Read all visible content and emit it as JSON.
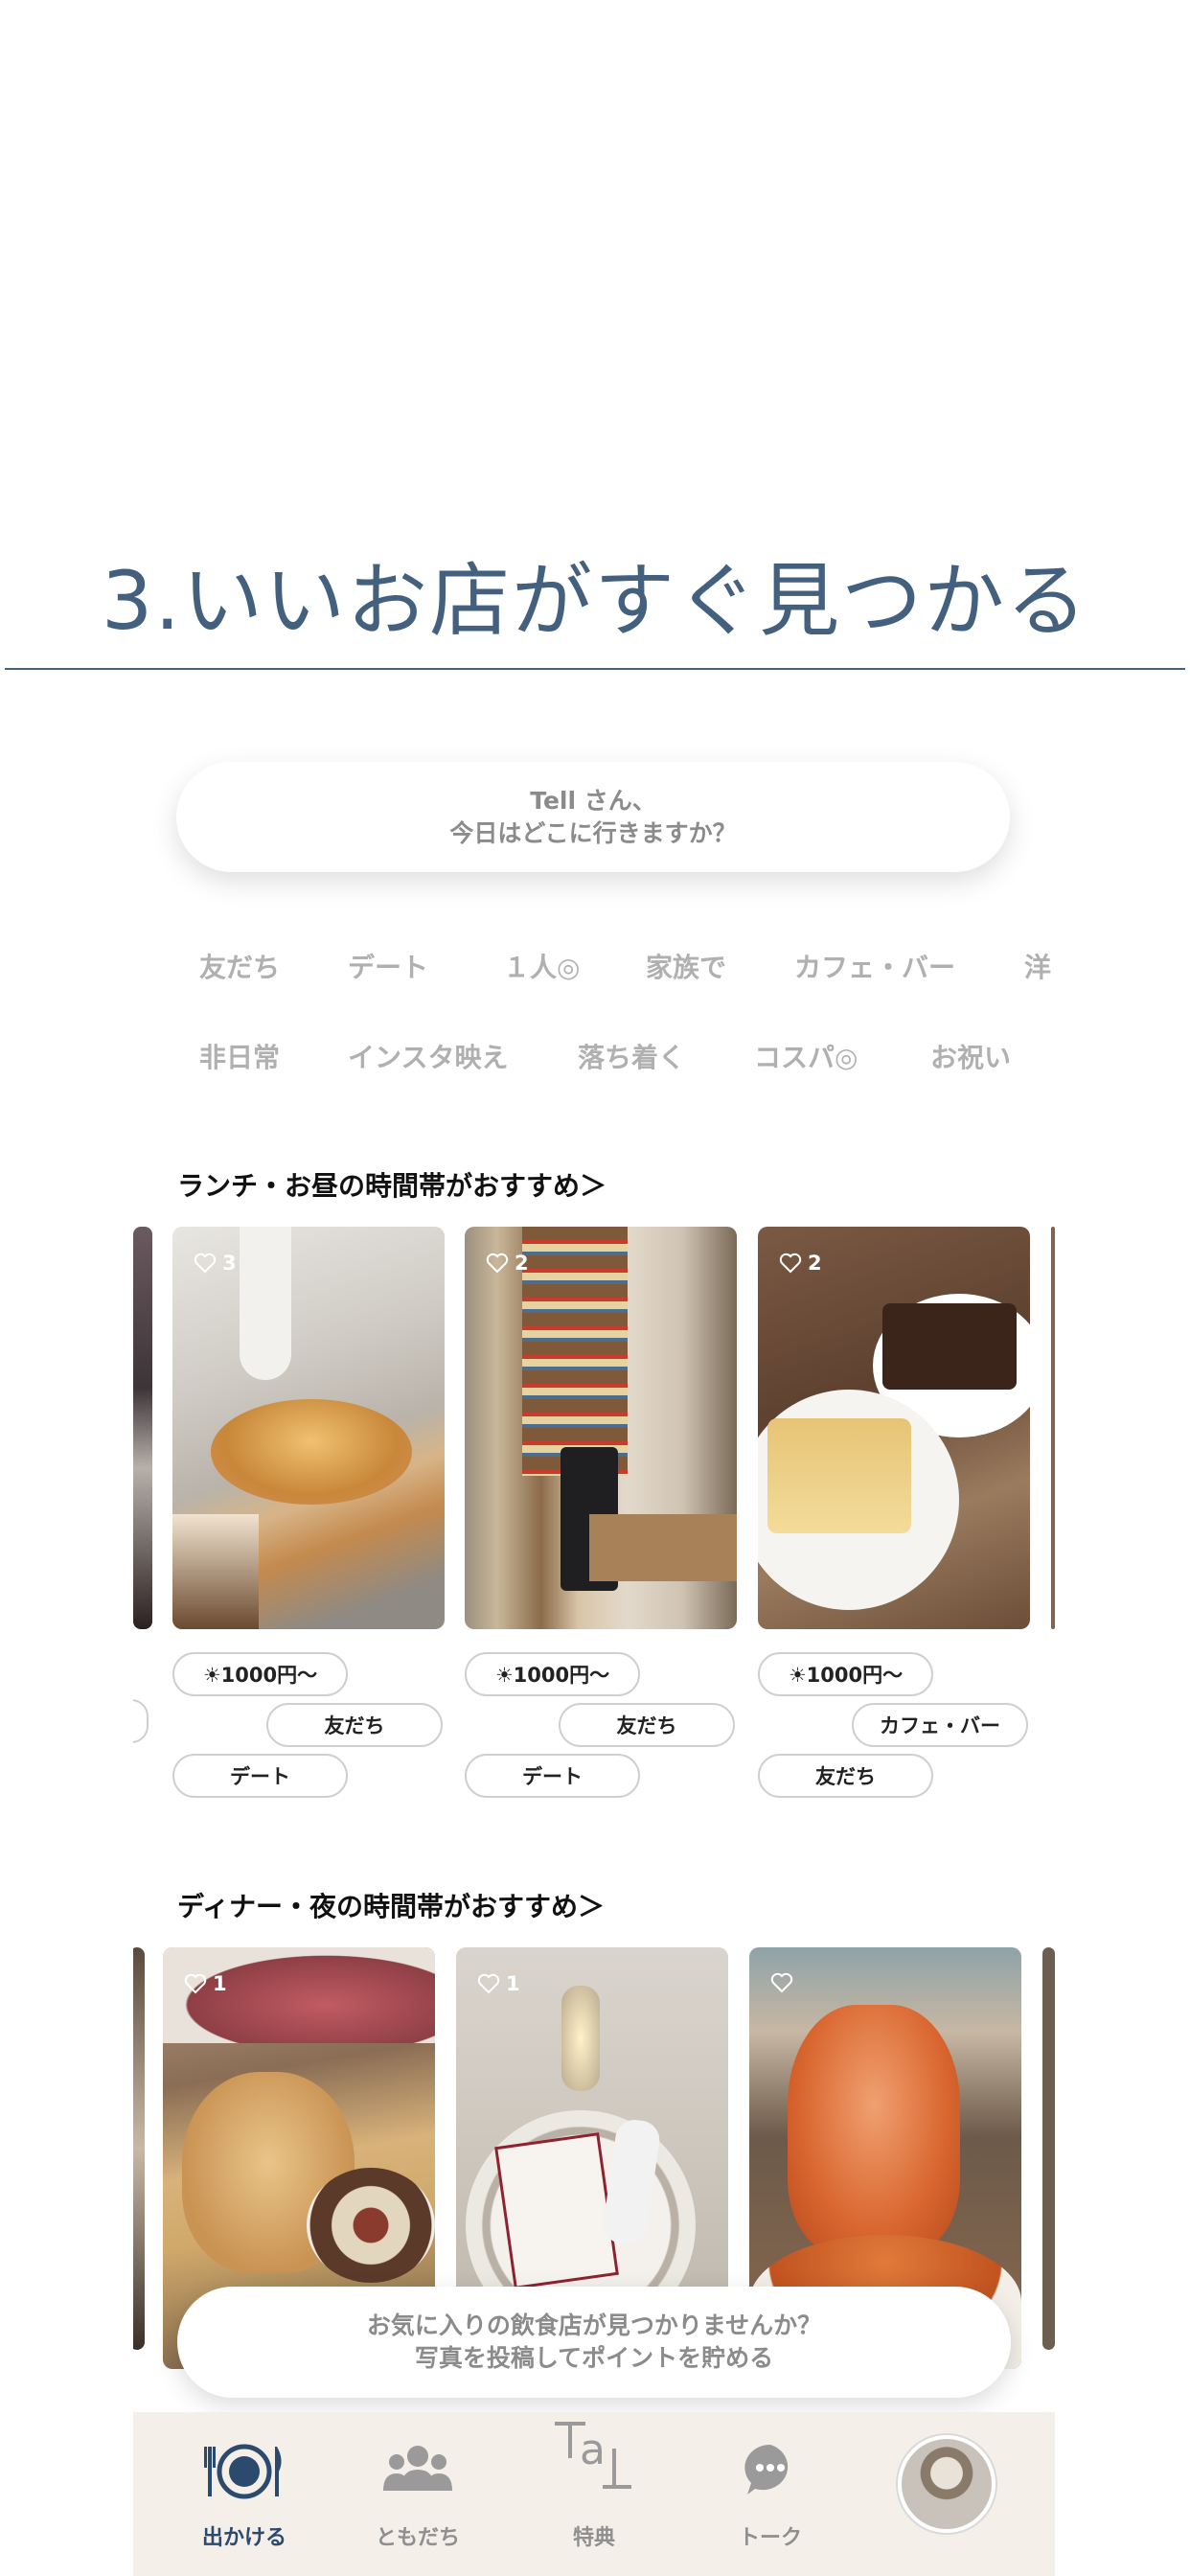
{
  "headline": "3.いいお店がすぐ見つかる",
  "greeting": {
    "line1": "Tell さん、",
    "line2": "今日はどこに行きますか？"
  },
  "chips_row1": [
    "友だち",
    "デート",
    "１人◎",
    "家族で",
    "カフェ・バー",
    "洋"
  ],
  "chips_row2": [
    "非日常",
    "インスタ映え",
    "落ち着く",
    "コスパ◎",
    "お祝い"
  ],
  "lunch": {
    "title": "ランチ・お昼の時間帯がおすすめ＞",
    "cards": [
      {
        "likes": "3",
        "tags": [
          "☀1000円〜",
          "友だち",
          "デート"
        ]
      },
      {
        "likes": "2",
        "tags": [
          "☀1000円〜",
          "友だち",
          "デート"
        ]
      },
      {
        "likes": "2",
        "tags": [
          "☀1000円〜",
          "カフェ・バー",
          "友だち"
        ]
      }
    ]
  },
  "dinner": {
    "title": "ディナー・夜の時間帯がおすすめ＞",
    "cards": [
      {
        "likes": "1"
      },
      {
        "likes": "1"
      },
      {
        "likes": ""
      }
    ]
  },
  "banner": {
    "line1": "お気に入りの飲食店が見つかりませんか？",
    "line2": "写真を投稿してポイントを貯める"
  },
  "tabs": [
    {
      "label": "出かける",
      "icon": "dining-icon"
    },
    {
      "label": "ともだち",
      "icon": "friends-icon"
    },
    {
      "label": "特典",
      "icon": "perks-icon"
    },
    {
      "label": "トーク",
      "icon": "chat-icon"
    },
    {
      "label": "",
      "icon": "avatar"
    }
  ],
  "colors": {
    "accent": "#44607f",
    "active_tab": "#2c4a6e",
    "tabbar_bg": "#f5efea"
  }
}
